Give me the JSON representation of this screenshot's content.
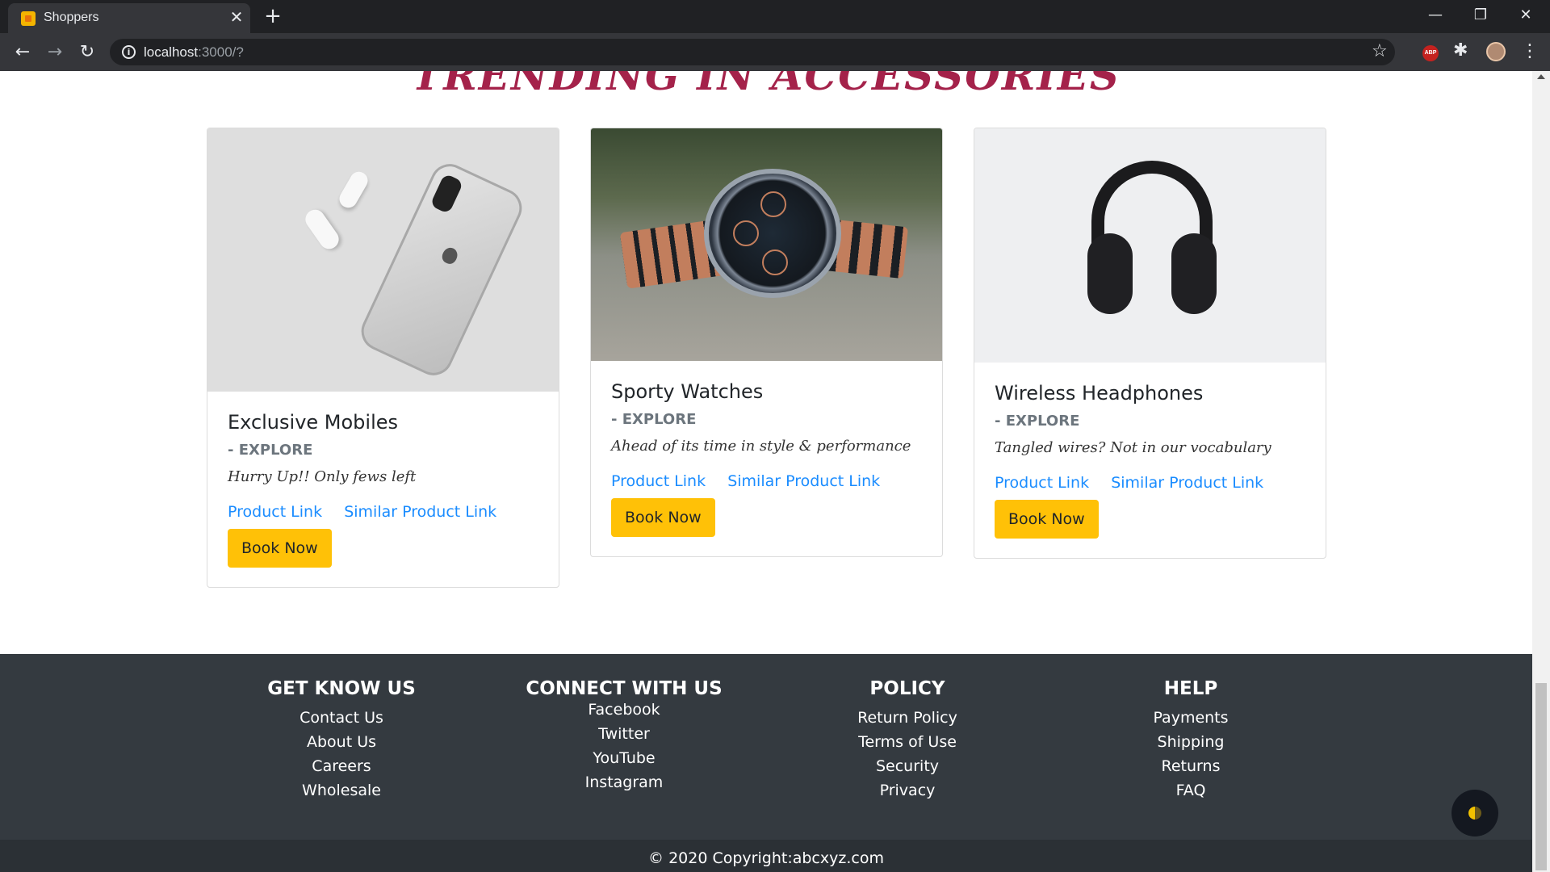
{
  "browser": {
    "tab_title": "Shoppers",
    "tab_close_glyph": "✕",
    "new_tab_glyph": "+",
    "url_host": "localhost",
    "url_path": ":3000/?",
    "back_glyph": "←",
    "forward_glyph": "→",
    "reload_glyph": "↻",
    "star_glyph": "☆",
    "abp_label": "ABP",
    "extensions_glyph": "✱",
    "menu_glyph": "⋮",
    "minimize_glyph": "—",
    "restore_glyph": "❐",
    "close_glyph": "✕"
  },
  "section": {
    "heading": "TRENDING IN ACCESSORIES"
  },
  "products": [
    {
      "title": "Exclusive Mobiles",
      "subtitle": "- EXPLORE",
      "text": "Hurry Up!! Only fews left",
      "link1": "Product Link",
      "link2": "Similar Product Link",
      "button": "Book Now"
    },
    {
      "title": "Sporty Watches",
      "subtitle": "- EXPLORE",
      "text": "Ahead of its time in style & performance",
      "link1": "Product Link",
      "link2": "Similar Product Link",
      "button": "Book Now"
    },
    {
      "title": "Wireless Headphones",
      "subtitle": "- EXPLORE",
      "text": "Tangled wires? Not in our vocabulary",
      "link1": "Product Link",
      "link2": "Similar Product Link",
      "button": "Book Now"
    }
  ],
  "footer": {
    "columns": [
      {
        "heading": "GET KNOW US",
        "links": [
          "Contact Us",
          "About Us",
          "Careers",
          "Wholesale"
        ]
      },
      {
        "heading": "CONNECT WITH US",
        "links": [
          "Facebook",
          "Twitter",
          "YouTube",
          "Instagram"
        ]
      },
      {
        "heading": "POLICY",
        "links": [
          "Return Policy",
          "Terms of Use",
          "Security",
          "Privacy"
        ]
      },
      {
        "heading": "HELP",
        "links": [
          "Payments",
          "Shipping",
          "Returns",
          "FAQ"
        ]
      }
    ],
    "copyright": "© 2020 Copyright:abcxyz.com"
  },
  "colors": {
    "heading": "#a4224a",
    "link": "#1a8cff",
    "button": "#ffc107",
    "footer_bg": "#343a40"
  }
}
